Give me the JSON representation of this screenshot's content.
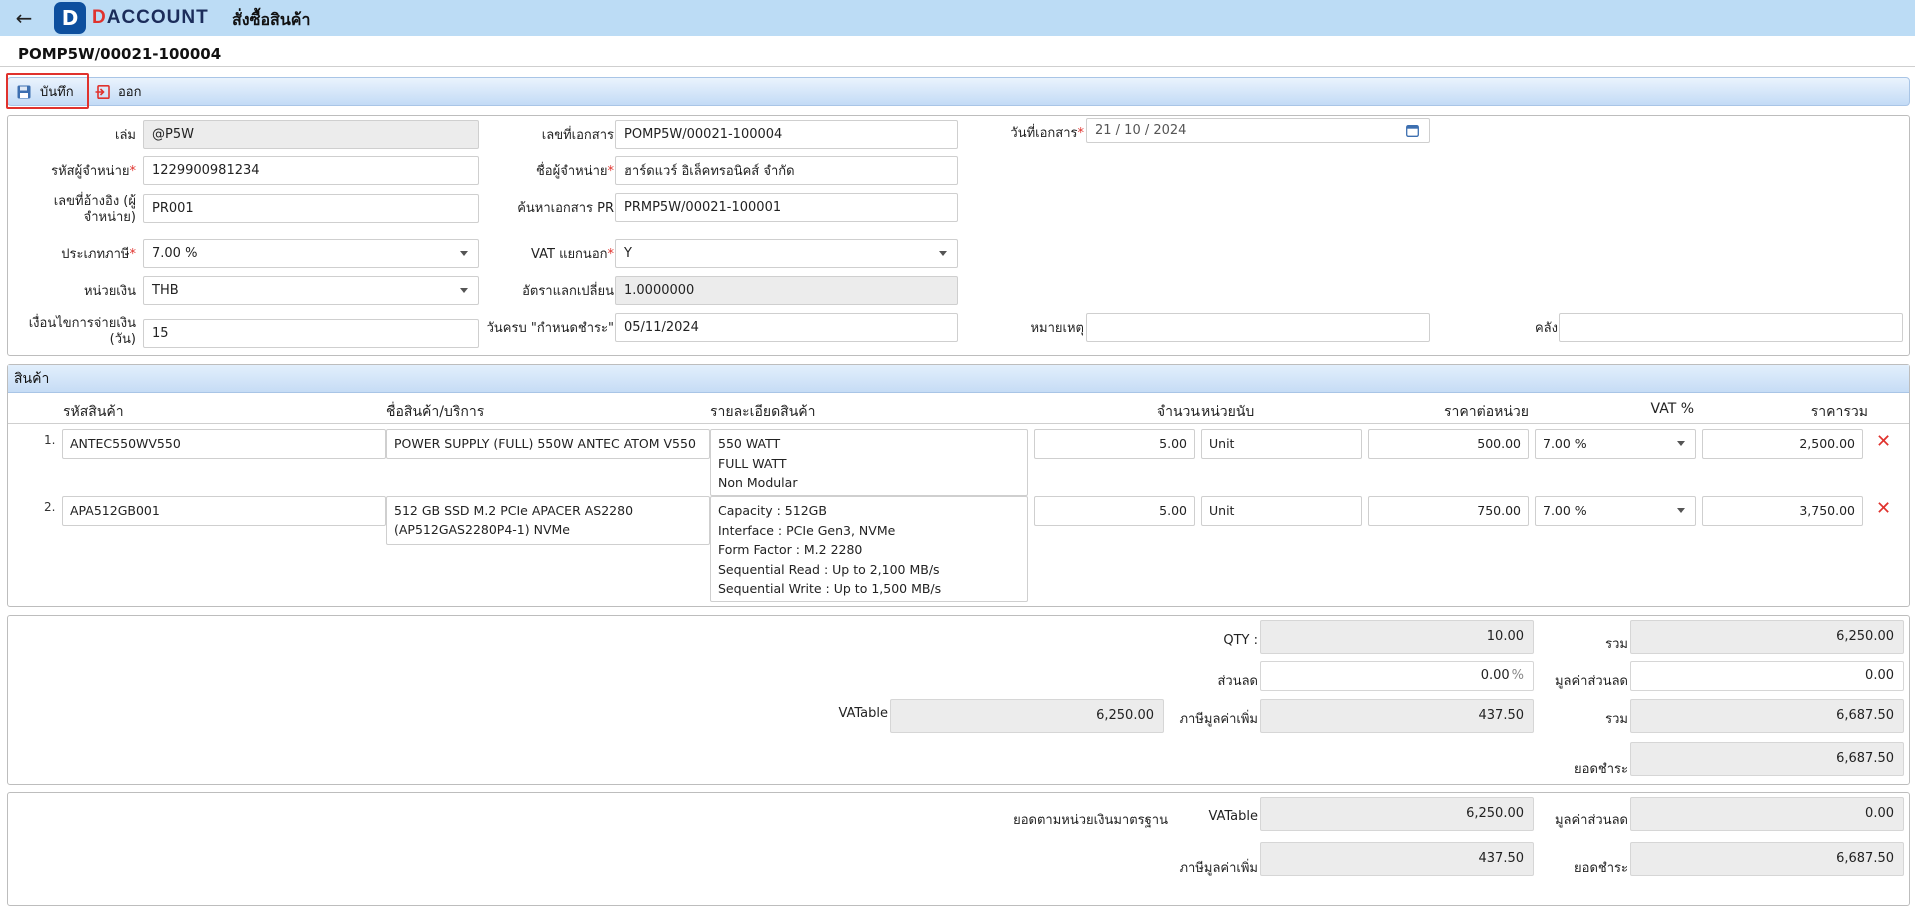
{
  "header": {
    "logo_letter": "D",
    "logo_d": "D",
    "logo_rest": "ACCOUNT",
    "title": "สั่งซื้อสินค้า",
    "back_icon": "arrow-left-icon"
  },
  "document_number": "POMP5W/00021-100004",
  "toolbar": {
    "save_label": "บันทึก",
    "exit_label": "ออก"
  },
  "form": {
    "book_label": "เล่ม",
    "book_value": "@P5W",
    "doc_no_label": "เลขที่เอกสาร",
    "doc_no_value": "POMP5W/00021-100004",
    "doc_date_label": "วันที่เอกสาร",
    "doc_date_value": "21 / 10 / 2024",
    "vendor_code_label": "รหัสผู้จำหน่าย",
    "vendor_code_value": "1229900981234",
    "vendor_name_label": "ชื่อผู้จำหน่าย",
    "vendor_name_value": "ฮาร์ดแวร์ อิเล็คทรอนิคส์ จำกัด",
    "ref_no_label_1": "เลขที่อ้างอิง (ผู้",
    "ref_no_label_2": "จำหน่าย)",
    "ref_no_value": "PR001",
    "pr_search_label": "ค้นหาเอกสาร PR",
    "pr_search_value": "PRMP5W/00021-100001",
    "tax_type_label": "ประเภทภาษี",
    "tax_type_value": "7.00 %",
    "vat_sep_label": "VAT แยกนอก",
    "vat_sep_value": "Y",
    "currency_label": "หน่วยเงิน",
    "currency_value": "THB",
    "rate_label": "อัตราแลกเปลี่ยน",
    "rate_value": "1.0000000",
    "pay_term_label_1": "เงื่อนไขการจ่ายเงิน",
    "pay_term_label_2": "(วัน)",
    "pay_term_value": "15",
    "due_label": "วันครบ \"กำหนดชำระ\"",
    "due_value": "05/11/2024",
    "note_label": "หมายเหตุ",
    "note_value": "",
    "warehouse_label": "คลัง",
    "warehouse_value": ""
  },
  "products": {
    "section_title": "สินค้า",
    "columns": {
      "code": "รหัสสินค้า",
      "name": "ชื่อสินค้า/บริการ",
      "detail": "รายละเอียดสินค้า",
      "qty": "จำนวน",
      "unit": "หน่วยนับ",
      "price": "ราคาต่อหน่วย",
      "vat": "VAT %",
      "total": "ราคารวม"
    },
    "rows": [
      {
        "num": "1.",
        "code": "ANTEC550WV550",
        "name_1": "POWER SUPPLY (FULL) 550W ANTEC ATOM V550",
        "name_2": "",
        "detail_1": "550 WATT",
        "detail_2": "FULL WATT",
        "detail_3": "Non Modular",
        "detail_4": "",
        "detail_5": "",
        "qty": "5.00",
        "unit": "Unit",
        "price": "500.00",
        "vat": "7.00 %",
        "total": "2,500.00"
      },
      {
        "num": "2.",
        "code": "APA512GB001",
        "name_1": "512 GB SSD M.2 PCIe APACER AS2280",
        "name_2": "(AP512GAS2280P4-1) NVMe",
        "detail_1": "Capacity : 512GB",
        "detail_2": "Interface : PCIe Gen3, NVMe",
        "detail_3": "Form Factor : M.2 2280",
        "detail_4": "Sequential Read : Up to 2,100 MB/s",
        "detail_5": "Sequential Write : Up to 1,500 MB/s",
        "qty": "5.00",
        "unit": "Unit",
        "price": "750.00",
        "vat": "7.00 %",
        "total": "3,750.00"
      }
    ]
  },
  "summary": {
    "qty_label": "QTY :",
    "qty_value": "10.00",
    "sum_label": "รวม",
    "sum_value": "6,250.00",
    "discount_label": "ส่วนลด",
    "discount_value": "0.00",
    "discount_unit": "%",
    "discount_amount_label": "มูลค่าส่วนลด",
    "discount_amount_value": "0.00",
    "vatable_label": "VATable",
    "vatable_value": "6,250.00",
    "vat_label": "ภาษีมูลค่าเพิ่ม",
    "vat_value": "437.50",
    "total_label": "รวม",
    "total_value": "6,687.50",
    "payable_label": "ยอดชำระ",
    "payable_value": "6,687.50"
  },
  "standard": {
    "title": "ยอดตามหน่วยเงินมาตรฐาน",
    "vatable_label": "VATable",
    "vatable_value": "6,250.00",
    "discount_amount_label": "มูลค่าส่วนลด",
    "discount_amount_value": "0.00",
    "vat_label": "ภาษีมูลค่าเพิ่ม",
    "vat_value": "437.50",
    "payable_label": "ยอดชำระ",
    "payable_value": "6,687.50"
  }
}
